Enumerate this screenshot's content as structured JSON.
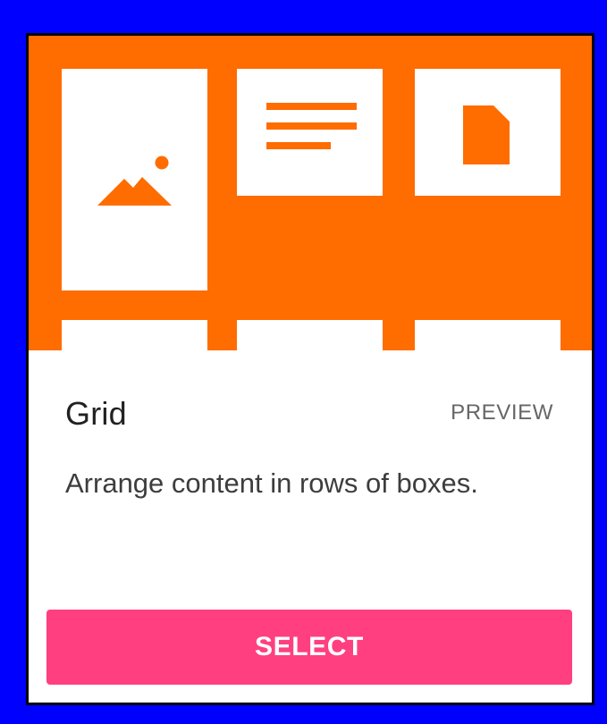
{
  "card": {
    "title": "Grid",
    "preview_label": "PREVIEW",
    "description": "Arrange content in rows of boxes.",
    "select_label": "SELECT"
  },
  "hero": {
    "tiles": [
      {
        "icon": "image-icon"
      },
      {
        "icon": "text-lines-icon"
      },
      {
        "icon": "document-icon"
      }
    ]
  },
  "colors": {
    "background": "#0000ff",
    "hero": "#ff6c00",
    "button": "#ff3f80",
    "title": "#212121",
    "preview": "#666666",
    "description": "#3d3d3d"
  }
}
